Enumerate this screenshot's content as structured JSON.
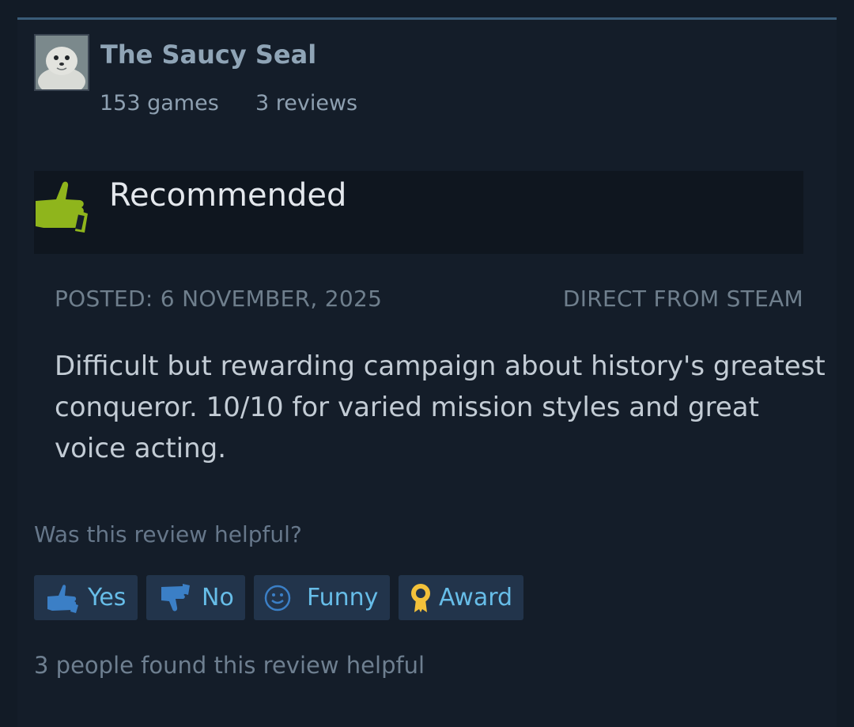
{
  "reviewer": {
    "name": "The Saucy Seal",
    "games": "153 games",
    "reviews": "3 reviews"
  },
  "verdict": {
    "label": "Recommended",
    "icon": "thumbs-up-icon"
  },
  "meta": {
    "posted": "POSTED: 6 NOVEMBER, 2025",
    "source": "DIRECT FROM STEAM"
  },
  "review_text": "Difficult but rewarding campaign about history's greatest conqueror. 10/10 for varied mission styles and great voice acting.",
  "helpful": {
    "question": "Was this review helpful?",
    "buttons": {
      "yes": "Yes",
      "no": "No",
      "funny": "Funny",
      "award": "Award"
    },
    "summary": "3 people found this review helpful"
  },
  "colors": {
    "background": "#121b26",
    "accent_link": "#67bde8",
    "recommend_green": "#8fb51c",
    "award_gold": "#f3c13a"
  }
}
